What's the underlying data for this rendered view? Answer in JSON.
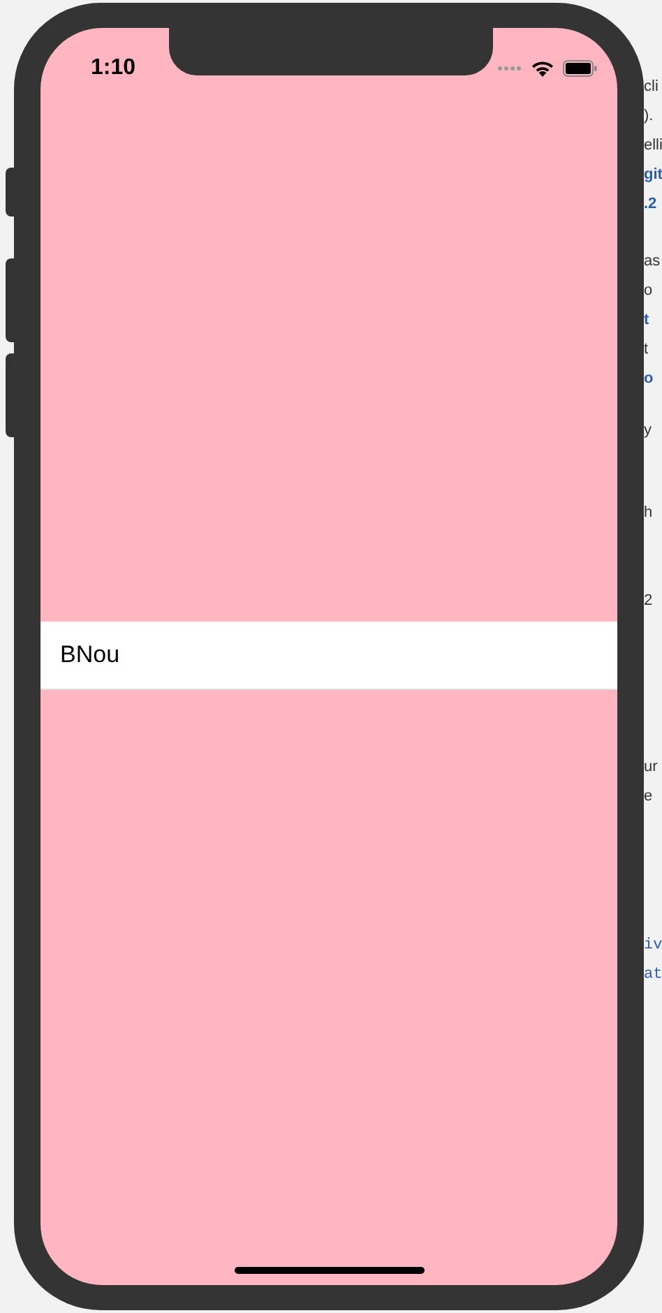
{
  "status_bar": {
    "time": "1:10"
  },
  "list": {
    "rows": [
      {
        "title": "BNou"
      }
    ]
  },
  "background": {
    "blocks": [
      {
        "lines": [
          {
            "text": "cli",
            "kind": "text"
          },
          {
            "text": ").",
            "kind": "text"
          },
          {
            "text": "elli",
            "kind": "text"
          },
          {
            "text": "git",
            "kind": "link"
          },
          {
            "text": ".2",
            "kind": "link"
          }
        ]
      },
      {
        "lines": [
          {
            "text": "as",
            "kind": "text"
          },
          {
            "text": "o",
            "kind": "text"
          },
          {
            "text": "t",
            "kind": "link"
          },
          {
            "text": "t",
            "kind": "text"
          },
          {
            "text": "o",
            "kind": "link"
          }
        ]
      },
      {
        "lines": [
          {
            "text": "y",
            "kind": "text"
          }
        ]
      },
      {
        "lines": [
          {
            "text": "h",
            "kind": "text"
          }
        ]
      },
      {
        "lines": [
          {
            "text": "2",
            "kind": "text"
          }
        ]
      },
      {
        "lines": [
          {
            "text": "ur",
            "kind": "text"
          },
          {
            "text": "e",
            "kind": "text"
          }
        ]
      },
      {
        "lines": [
          {
            "text": "iv",
            "kind": "code"
          },
          {
            "text": "at",
            "kind": "code"
          }
        ]
      }
    ]
  }
}
